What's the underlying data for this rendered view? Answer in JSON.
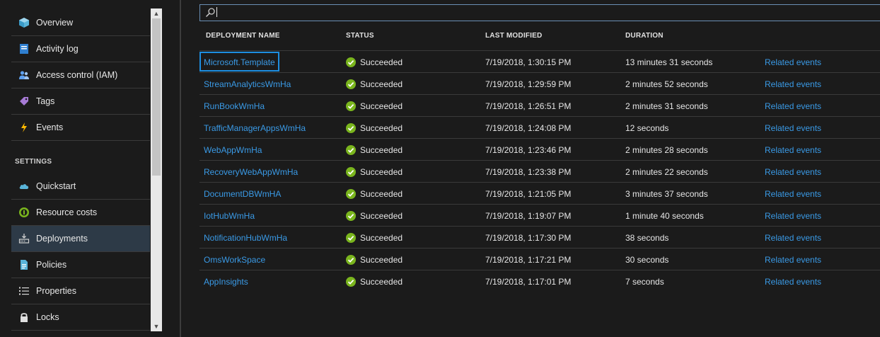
{
  "sidebar": {
    "items": [
      {
        "label": "Overview",
        "icon": "cube-icon"
      },
      {
        "label": "Activity log",
        "icon": "activity-log-icon"
      },
      {
        "label": "Access control (IAM)",
        "icon": "users-icon"
      },
      {
        "label": "Tags",
        "icon": "tag-icon"
      },
      {
        "label": "Events",
        "icon": "lightning-icon"
      }
    ],
    "settings_heading": "SETTINGS",
    "settings_items": [
      {
        "label": "Quickstart",
        "icon": "cloud-icon"
      },
      {
        "label": "Resource costs",
        "icon": "coin-icon"
      },
      {
        "label": "Deployments",
        "icon": "deployments-icon",
        "active": true
      },
      {
        "label": "Policies",
        "icon": "document-icon"
      },
      {
        "label": "Properties",
        "icon": "list-icon"
      },
      {
        "label": "Locks",
        "icon": "lock-icon"
      }
    ]
  },
  "search": {
    "value": "",
    "placeholder": ""
  },
  "table": {
    "columns": {
      "name": "DEPLOYMENT NAME",
      "status": "STATUS",
      "modified": "LAST MODIFIED",
      "duration": "DURATION"
    },
    "rows": [
      {
        "name": "Microsoft.Template",
        "status": "Succeeded",
        "modified": "7/19/2018, 1:30:15 PM",
        "duration": "13 minutes 31 seconds",
        "related": "Related events"
      },
      {
        "name": "StreamAnalyticsWmHa",
        "status": "Succeeded",
        "modified": "7/19/2018, 1:29:59 PM",
        "duration": "2 minutes 52 seconds",
        "related": "Related events"
      },
      {
        "name": "RunBookWmHa",
        "status": "Succeeded",
        "modified": "7/19/2018, 1:26:51 PM",
        "duration": "2 minutes 31 seconds",
        "related": "Related events"
      },
      {
        "name": "TrafficManagerAppsWmHa",
        "status": "Succeeded",
        "modified": "7/19/2018, 1:24:08 PM",
        "duration": "12 seconds",
        "related": "Related events"
      },
      {
        "name": "WebAppWmHa",
        "status": "Succeeded",
        "modified": "7/19/2018, 1:23:46 PM",
        "duration": "2 minutes 28 seconds",
        "related": "Related events"
      },
      {
        "name": "RecoveryWebAppWmHa",
        "status": "Succeeded",
        "modified": "7/19/2018, 1:23:38 PM",
        "duration": "2 minutes 22 seconds",
        "related": "Related events"
      },
      {
        "name": "DocumentDBWmHA",
        "status": "Succeeded",
        "modified": "7/19/2018, 1:21:05 PM",
        "duration": "3 minutes 37 seconds",
        "related": "Related events"
      },
      {
        "name": "IotHubWmHa",
        "status": "Succeeded",
        "modified": "7/19/2018, 1:19:07 PM",
        "duration": "1 minute 40 seconds",
        "related": "Related events"
      },
      {
        "name": "NotificationHubWmHa",
        "status": "Succeeded",
        "modified": "7/19/2018, 1:17:30 PM",
        "duration": "38 seconds",
        "related": "Related events"
      },
      {
        "name": "OmsWorkSpace",
        "status": "Succeeded",
        "modified": "7/19/2018, 1:17:21 PM",
        "duration": "30 seconds",
        "related": "Related events"
      },
      {
        "name": "AppInsights",
        "status": "Succeeded",
        "modified": "7/19/2018, 1:17:01 PM",
        "duration": "7 seconds",
        "related": "Related events"
      }
    ]
  },
  "colors": {
    "link": "#3a9ae6",
    "success": "#7ab51d",
    "active_item": "#2d3a47",
    "focus": "#1d8ee0"
  }
}
